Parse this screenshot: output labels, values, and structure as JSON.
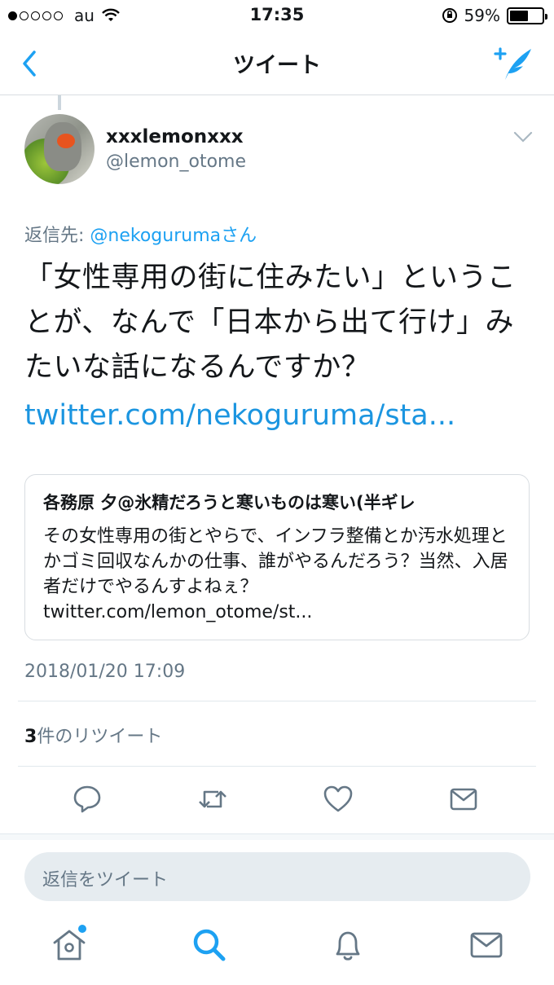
{
  "status_bar": {
    "carrier": "au",
    "time": "17:35",
    "battery": "59%",
    "battery_level": 0.59
  },
  "nav": {
    "title": "ツイート"
  },
  "tweet": {
    "display_name": "xxxlemonxxx",
    "handle": "@lemon_otome",
    "reply_prefix": "返信先: ",
    "reply_mention": "@nekoguruma",
    "reply_suffix": "さん",
    "text": "「女性専用の街に住みたい」ということが、なんで「日本から出て行け」みたいな話になるんですか？",
    "link": "twitter.com/nekoguruma/sta...",
    "timestamp": "2018/01/20 17:09",
    "retweet_count": "3",
    "retweet_label": "件のリツイート"
  },
  "quote": {
    "author": "各務原 夕@氷精だろうと寒いものは寒い(半ギレ",
    "text": "その女性専用の街とやらで、インフラ整備とか汚水処理とかゴミ回収なんかの仕事、誰がやるんだろう？当然、入居者だけでやるんすよねぇ？",
    "link": "twitter.com/lemon_otome/st..."
  },
  "reply_box": {
    "placeholder": "返信をツイート"
  },
  "colors": {
    "accent": "#1da1f2",
    "link": "#1b95e0",
    "secondary_text": "#657786",
    "icon_gray": "#657786"
  },
  "icons": {
    "back": "chevron-left-icon",
    "compose": "compose-tweet-icon",
    "reply": "reply-icon",
    "retweet": "retweet-icon",
    "like": "heart-icon",
    "dm": "envelope-icon",
    "home": "home-icon",
    "search": "search-icon",
    "notifications": "bell-icon",
    "messages": "envelope-icon"
  }
}
